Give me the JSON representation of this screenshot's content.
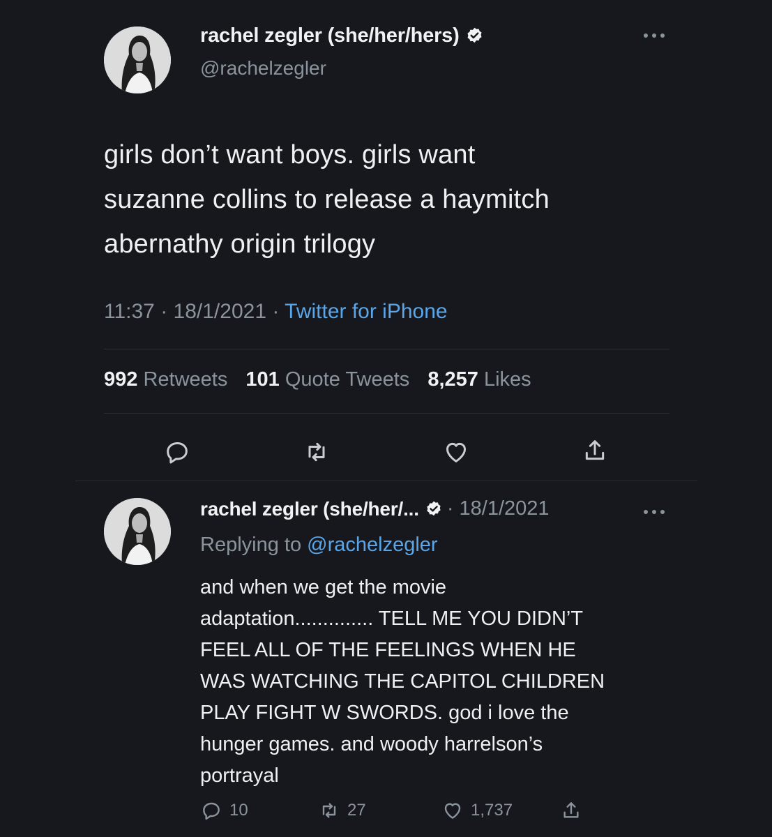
{
  "main_tweet": {
    "display_name": "rachel zegler (she/her/hers)",
    "handle": "@rachelzegler",
    "text": "girls don’t want boys. girls want\nsuzanne collins to release a haymitch\nabernathy origin trilogy",
    "time": "11:37",
    "date": "18/1/2021",
    "separator": "·",
    "source": "Twitter for iPhone",
    "stats": {
      "retweets_count": "992",
      "retweets_label": "Retweets",
      "quotes_count": "101",
      "quotes_label": "Quote Tweets",
      "likes_count": "8,257",
      "likes_label": "Likes"
    }
  },
  "reply_tweet": {
    "display_name": "rachel zegler (she/her/...",
    "date": "· 18/1/2021",
    "replying_prefix": "Replying to",
    "replying_to": "@rachelzegler",
    "text": "and when we get the movie\nadaptation.............. TELL ME YOU DIDN’T\nFEEL ALL OF THE FEELINGS WHEN HE\nWAS WATCHING THE CAPITOL CHILDREN\nPLAY FIGHT W SWORDS. god i love the\nhunger games. and woody harrelson’s\nportrayal",
    "reply_count": "10",
    "retweet_count": "27",
    "like_count": "1,737"
  },
  "icons": {
    "verified": "verified-badge-icon",
    "more": "more-options-icon",
    "reply": "reply-icon",
    "retweet": "retweet-icon",
    "like": "heart-icon",
    "share": "share-icon"
  },
  "colors": {
    "background": "#16181d",
    "text": "#eef0f2",
    "secondary": "#8b949c",
    "link": "#5aa6e8",
    "divider": "#2b3037"
  }
}
